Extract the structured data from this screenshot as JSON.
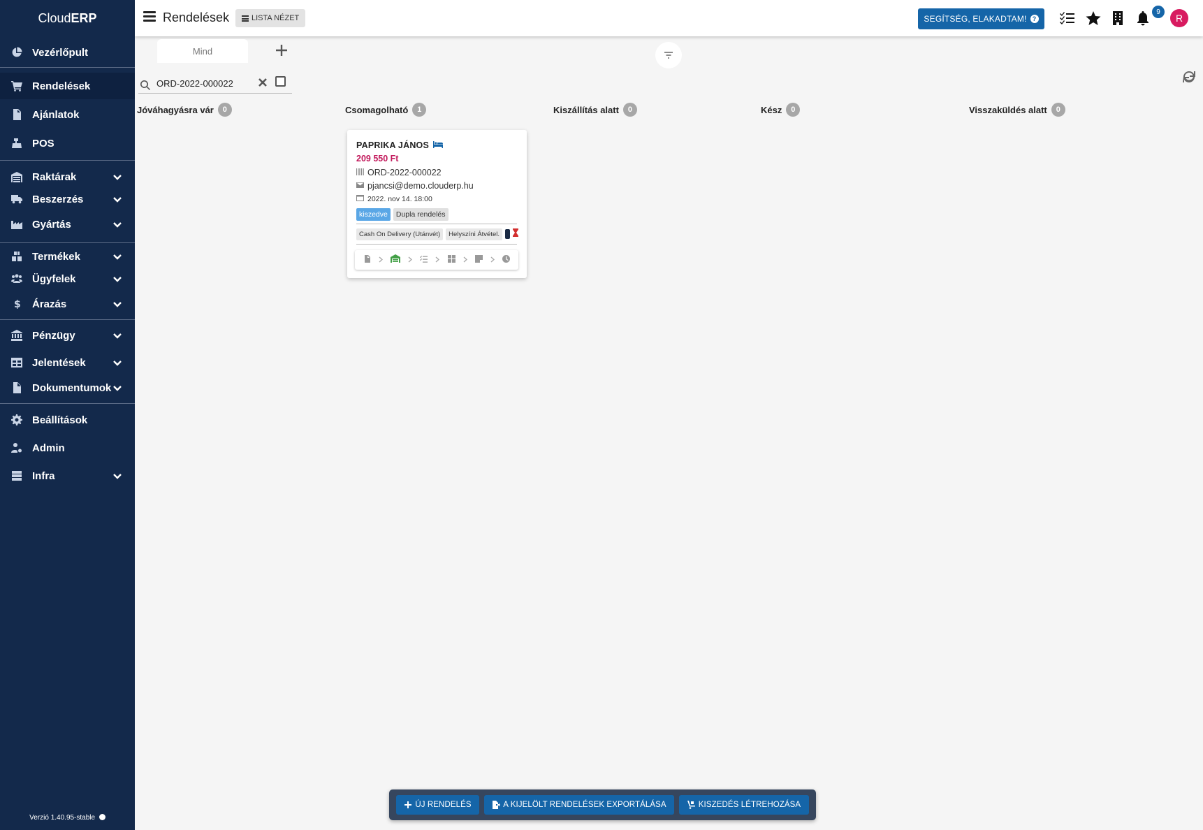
{
  "brand": {
    "prefix": "Cloud",
    "bold": "ERP"
  },
  "sidebar": {
    "items": [
      {
        "label": "Vezérlőpult",
        "icon": "pie-chart-icon"
      },
      {
        "label": "Rendelések",
        "icon": "cart-icon",
        "active": true
      },
      {
        "label": "Ajánlatok",
        "icon": "document-dollar-icon"
      },
      {
        "label": "POS",
        "icon": "cash-register-icon"
      },
      {
        "label": "Raktárak",
        "icon": "warehouse-icon",
        "expandable": true
      },
      {
        "label": "Beszerzés",
        "icon": "truck-icon",
        "expandable": true
      },
      {
        "label": "Gyártás",
        "icon": "factory-icon",
        "expandable": true
      },
      {
        "label": "Termékek",
        "icon": "boxes-icon",
        "expandable": true
      },
      {
        "label": "Ügyfelek",
        "icon": "users-icon",
        "expandable": true
      },
      {
        "label": "Árazás",
        "icon": "dollar-icon",
        "expandable": true
      },
      {
        "label": "Pénzügy",
        "icon": "bank-icon",
        "expandable": true
      },
      {
        "label": "Jelentések",
        "icon": "table-icon",
        "expandable": true
      },
      {
        "label": "Dokumentumok",
        "icon": "file-icon",
        "expandable": true
      },
      {
        "label": "Beállítások",
        "icon": "gear-icon"
      },
      {
        "label": "Admin",
        "icon": "user-cog-icon"
      },
      {
        "label": "Infra",
        "icon": "server-icon",
        "expandable": true
      }
    ],
    "version": "Verzió 1.40.95-stable"
  },
  "topbar": {
    "title": "Rendelések",
    "view_button": "LISTA NÉZET",
    "help_button": "SEGÍTSÉG, ELAKADTAM!",
    "help_q": "?",
    "notification_count": "9",
    "avatar_initial": "R"
  },
  "tabs": [
    {
      "label": "Mind"
    }
  ],
  "search": {
    "value": "ORD-2022-000022"
  },
  "columns": [
    {
      "title": "Jóváhagyásra vár",
      "count": "0"
    },
    {
      "title": "Csomagolható",
      "count": "1"
    },
    {
      "title": "Kiszállítás alatt",
      "count": "0"
    },
    {
      "title": "Kész",
      "count": "0"
    },
    {
      "title": "Visszaküldés alatt",
      "count": "0"
    }
  ],
  "card": {
    "customer": "PAPRIKA JÁNOS",
    "price": "209 550 Ft",
    "order_id": "ORD-2022-000022",
    "email": "pjancsi@demo.clouderp.hu",
    "date": "2022. nov 14. 18:00",
    "tags": [
      "kiszedve",
      "Dupla rendelés"
    ],
    "payment": "Cash On Delivery (Utánvét)",
    "shipping": "Helyszíni Átvétel.",
    "colors": {
      "price": "#c2185b",
      "tag_blue": "#5aa7e6",
      "step_done": "#43a047"
    }
  },
  "actions": {
    "new_order": "ÚJ RENDELÉS",
    "export": "A KIJELÖLT RENDELÉSEK EXPORTÁLÁSA",
    "picking": "KISZEDÉS LÉTREHOZÁSA"
  },
  "colors": {
    "sidebar": "#13294b",
    "accent": "#1565a8",
    "avatar": "#d81b60"
  }
}
